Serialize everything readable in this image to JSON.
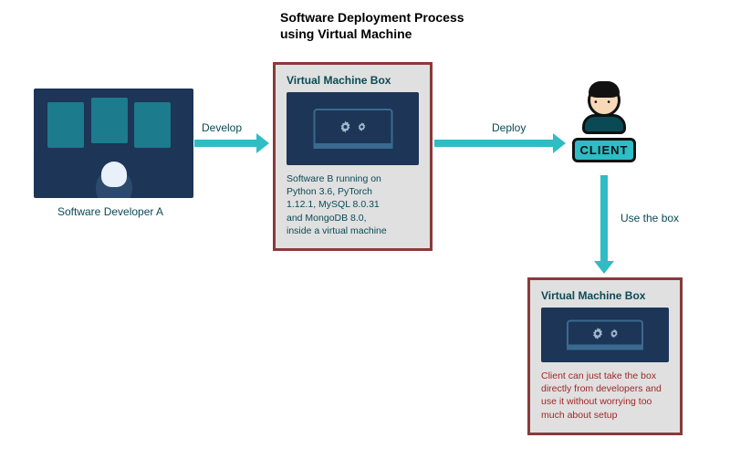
{
  "title": "Software Deployment Process\nusing Virtual Machine",
  "developer": {
    "label": "Software Developer A"
  },
  "arrows": {
    "develop": "Develop",
    "deploy": "Deploy",
    "use": "Use the box"
  },
  "vm1": {
    "title": "Virtual Machine Box",
    "desc": "Software B running on Python 3.6, PyTorch 1.12.1,  MySQL 8.0.31 and MongoDB 8.0, inside a virtual machine"
  },
  "client": {
    "badge": "CLIENT"
  },
  "vm2": {
    "title": "Virtual Machine Box",
    "desc": "Client can just take the box directly from developers and use it without worrying too much about setup"
  }
}
